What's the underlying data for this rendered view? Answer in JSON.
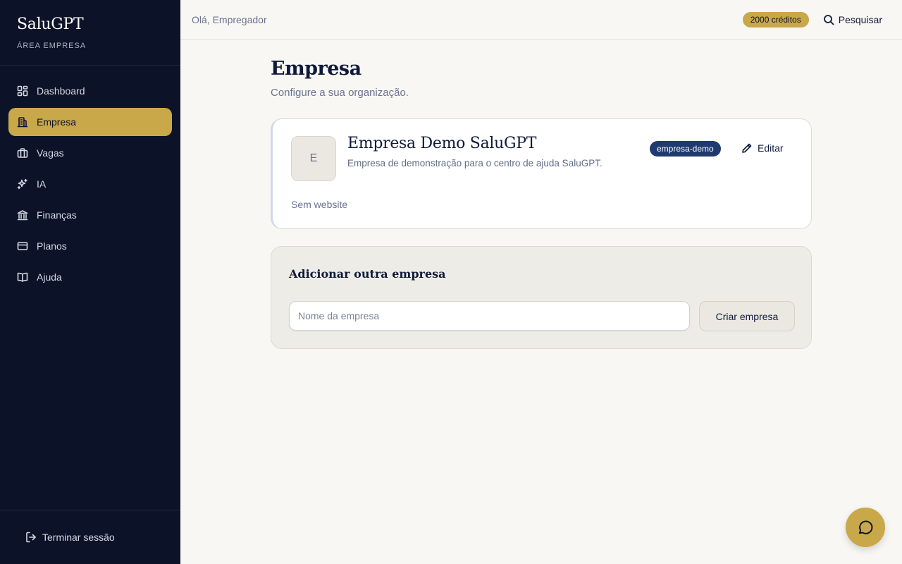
{
  "sidebar": {
    "brand": "SaluGPT",
    "subtitle": "ÁREA EMPRESA",
    "items": [
      {
        "label": "Dashboard",
        "icon": "dashboard-icon"
      },
      {
        "label": "Empresa",
        "icon": "building-icon",
        "active": true
      },
      {
        "label": "Vagas",
        "icon": "briefcase-icon"
      },
      {
        "label": "IA",
        "icon": "sparkles-icon"
      },
      {
        "label": "Finanças",
        "icon": "bank-icon"
      },
      {
        "label": "Planos",
        "icon": "credit-card-icon"
      },
      {
        "label": "Ajuda",
        "icon": "book-icon"
      }
    ],
    "logout_label": "Terminar sessão"
  },
  "topbar": {
    "greeting": "Olá, Empregador",
    "credits": "2000 créditos",
    "search_label": "Pesquisar"
  },
  "page": {
    "title": "Empresa",
    "subtitle": "Configure a sua organização."
  },
  "company": {
    "initial": "E",
    "name": "Empresa Demo SaluGPT",
    "description": "Empresa de demonstração para o centro de ajuda SaluGPT.",
    "slug": "empresa-demo",
    "edit_label": "Editar",
    "website": "Sem website"
  },
  "add_company": {
    "title": "Adicionar outra empresa",
    "input_placeholder": "Nome da empresa",
    "input_value": "",
    "button_label": "Criar empresa"
  },
  "colors": {
    "sidebar_bg": "#0c1328",
    "accent": "#c9a84a",
    "slug_badge": "#1f3a70",
    "page_bg": "#f8f7f3"
  }
}
